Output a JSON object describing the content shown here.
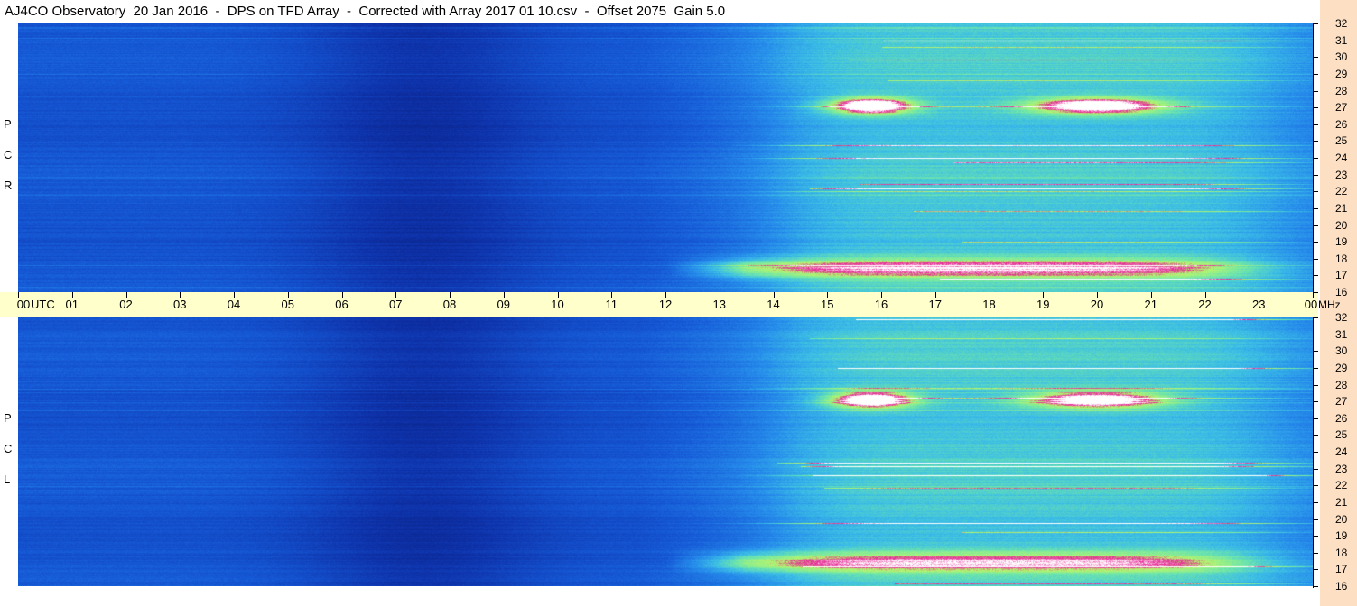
{
  "window": {
    "title": "AJ4CO Observatory  20 Jan 2016  -  DPS on TFD Array  -  Corrected with Array 2017 01 10.csv  -  Offset 2075  Gain 5.0"
  },
  "panels": {
    "rcp": {
      "label_letters": [
        "P",
        "C",
        "R"
      ]
    },
    "lcp": {
      "label_letters": [
        "P",
        "C",
        "L"
      ]
    }
  },
  "time_axis": {
    "unit_label": "UTC",
    "freq_unit": "MHz",
    "ticks": [
      "00",
      "01",
      "02",
      "03",
      "04",
      "05",
      "06",
      "07",
      "08",
      "09",
      "10",
      "11",
      "12",
      "13",
      "14",
      "15",
      "16",
      "17",
      "18",
      "19",
      "20",
      "21",
      "22",
      "23",
      "00"
    ]
  },
  "freq_axis": {
    "ticks": [
      "32",
      "31",
      "30",
      "29",
      "28",
      "27",
      "26",
      "25",
      "24",
      "23",
      "22",
      "21",
      "20",
      "19",
      "18",
      "17",
      "16"
    ]
  },
  "colors": {
    "time_bar": "#ffffcc",
    "freq_bar": "#fde0c4",
    "low": "#1a3ca8",
    "mid": "#2a8ae0",
    "high": "#a8f07a",
    "burst": "#e0208a",
    "peak": "#ffffff"
  },
  "chart_data": [
    {
      "type": "heatmap",
      "title": "AJ4CO Observatory  20 Jan 2016  -  DPS on TFD Array  -  Corrected with Array 2017 01 10.csv  -  Offset 2075  Gain 5.0",
      "panel": "RCP",
      "xlabel": "UTC",
      "ylabel": "MHz",
      "xlim": [
        0,
        24
      ],
      "ylim": [
        16,
        32
      ],
      "x_ticks": [
        "00",
        "01",
        "02",
        "03",
        "04",
        "05",
        "06",
        "07",
        "08",
        "09",
        "10",
        "11",
        "12",
        "13",
        "14",
        "15",
        "16",
        "17",
        "18",
        "19",
        "20",
        "21",
        "22",
        "23",
        "00"
      ],
      "y_ticks": [
        32,
        31,
        30,
        29,
        28,
        27,
        26,
        25,
        24,
        23,
        22,
        21,
        20,
        19,
        18,
        17,
        16
      ]
    },
    {
      "type": "heatmap",
      "panel": "LCP",
      "xlabel": "UTC",
      "ylabel": "MHz",
      "xlim": [
        0,
        24
      ],
      "ylim": [
        16,
        32
      ],
      "x_ticks": [
        "00",
        "01",
        "02",
        "03",
        "04",
        "05",
        "06",
        "07",
        "08",
        "09",
        "10",
        "11",
        "12",
        "13",
        "14",
        "15",
        "16",
        "17",
        "18",
        "19",
        "20",
        "21",
        "22",
        "23",
        "00"
      ],
      "y_ticks": [
        32,
        31,
        30,
        29,
        28,
        27,
        26,
        25,
        24,
        23,
        22,
        21,
        20,
        19,
        18,
        17,
        16
      ]
    }
  ]
}
